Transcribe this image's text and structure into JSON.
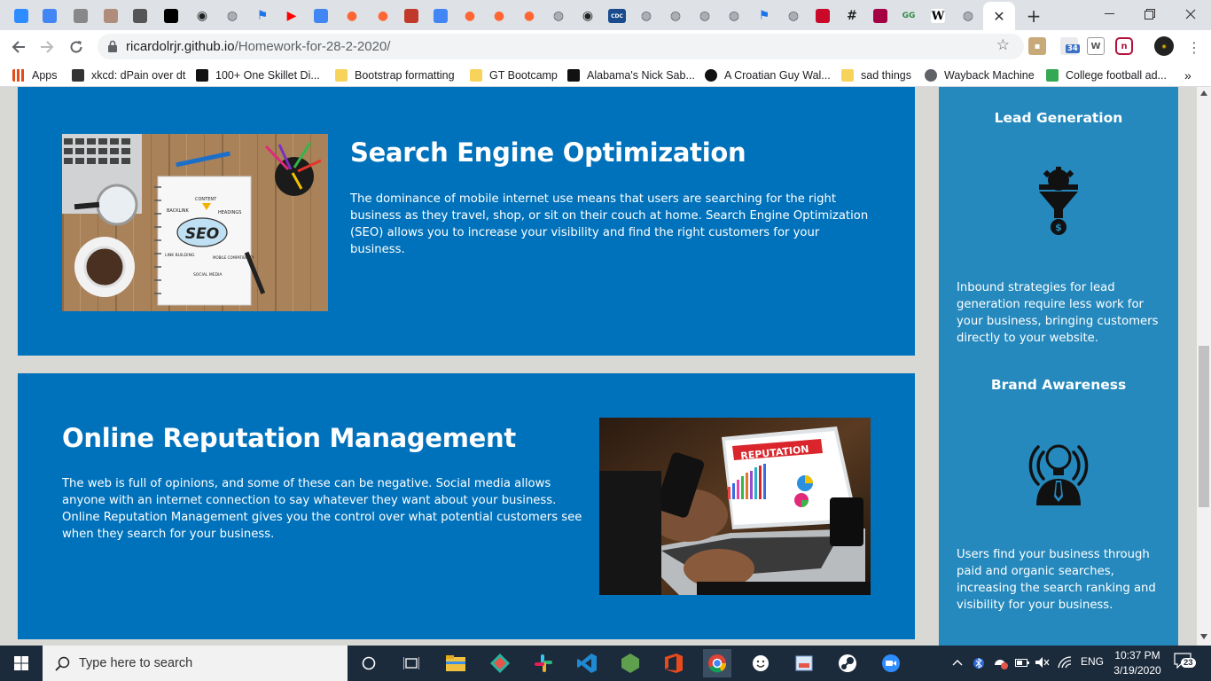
{
  "browser": {
    "tab_icons": [
      "zoom-icon",
      "docs-icon",
      "page-icon",
      "thumbnail-icon",
      "app-icon",
      "app-icon-black",
      "github-icon",
      "globe-icon",
      "flag-icon",
      "youtube-icon",
      "docs-icon",
      "reddit-icon",
      "reddit-icon",
      "web-icon",
      "google-icon",
      "reddit-icon",
      "reddit-icon",
      "reddit-icon",
      "globe-icon",
      "github-icon",
      "cdc-icon",
      "globe-icon",
      "globe-icon",
      "globe-icon",
      "globe-icon",
      "flag-icon",
      "globe-icon",
      "nba-icon",
      "hashtag-icon",
      "barcelona-icon",
      "geeksforgeeks-icon",
      "wikipedia-icon",
      "globe-icon"
    ],
    "tab_cdc_label": "CDC",
    "tab_gg_label": "GG",
    "tab_w_label": "W",
    "active_tab_close": "✕",
    "new_tab": "+",
    "url_host": "ricardolrjr.github.io",
    "url_path": "/Homework-for-28-2-2020/",
    "ext_badge": "34",
    "bookmarks": [
      {
        "label": "Apps",
        "icon": "apps-icon"
      },
      {
        "label": "xkcd: dPain over dt",
        "icon": "xkcd-icon"
      },
      {
        "label": "100+ One Skillet Di...",
        "icon": "d-icon"
      },
      {
        "label": "Bootstrap formatting",
        "icon": "folder-icon"
      },
      {
        "label": "GT Bootcamp",
        "icon": "folder-icon"
      },
      {
        "label": "Alabama's Nick Sab...",
        "icon": "i-icon"
      },
      {
        "label": "A Croatian Guy Wal...",
        "icon": "drop-icon"
      },
      {
        "label": "sad things",
        "icon": "folder-icon"
      },
      {
        "label": "Wayback Machine",
        "icon": "globe-icon"
      },
      {
        "label": "College football ad...",
        "icon": "drive-icon"
      }
    ],
    "bookmarks_more": "»"
  },
  "page": {
    "seo": {
      "title": "Search Engine Optimization",
      "body": "The dominance of mobile internet use means that users are searching for the right business as they travel, shop, or sit on their couch at home. Search Engine Optimization (SEO) allows you to increase your visibility and find the right customers for your business.",
      "image_words": [
        "CONTENT",
        "BACKLINK",
        "HEADINGS",
        "SEO",
        "LINK BUILDING",
        "MOBILE COMPATIBILITY",
        "SOCIAL MEDIA"
      ]
    },
    "orm": {
      "title": "Online Reputation Management",
      "body": "The web is full of opinions, and some of these can be negative. Social media allows anyone with an internet connection to say whatever they want about your business. Online Reputation Management gives you the control over what potential customers see when they search for your business.",
      "image_word": "REPUTATION"
    },
    "sidebar": {
      "lead": {
        "title": "Lead Generation",
        "body": "Inbound strategies for lead generation require less work for your business, bringing customers directly to your website.",
        "icon_symbol": "$"
      },
      "brand": {
        "title": "Brand Awareness",
        "body": "Users find your business through paid and organic searches, increasing the search ranking and visibility for your business."
      }
    }
  },
  "taskbar": {
    "search_placeholder": "Type here to search",
    "language": "ENG",
    "time": "10:37 PM",
    "date": "3/19/2020",
    "notification_count": "23"
  }
}
